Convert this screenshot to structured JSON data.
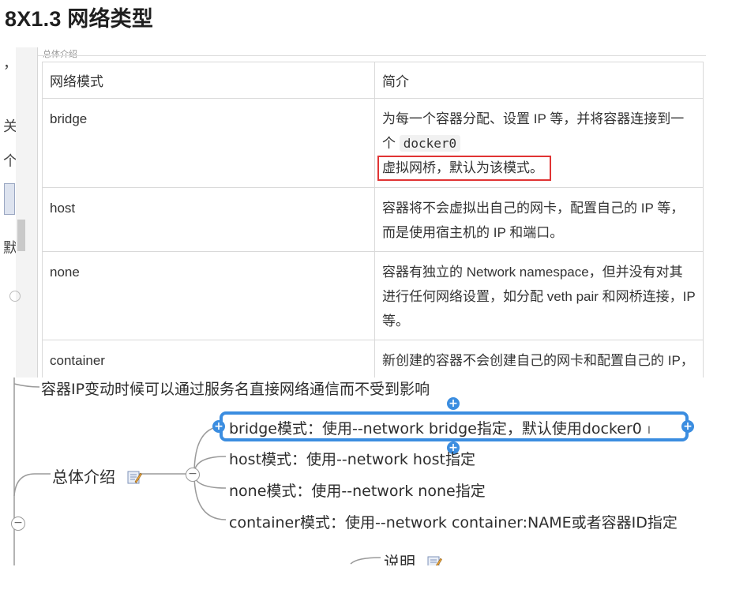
{
  "heading": "8X1.3 网络类型",
  "left_fragments": [
    "，",
    "关",
    "个",
    "默"
  ],
  "table": {
    "caption": "总体介绍",
    "headers": [
      "网络模式",
      "简介"
    ],
    "rows": [
      {
        "mode": "bridge",
        "desc_pre": "为每一个容器分配、设置 IP 等，并将容器连接到一个",
        "desc_code": "docker0",
        "desc_highlight": "虚拟网桥，默认为该模式。"
      },
      {
        "mode": "host",
        "desc": "容器将不会虚拟出自己的网卡，配置自己的 IP 等，而是使用宿主机的 IP 和端口。"
      },
      {
        "mode": "none",
        "desc": "容器有独立的 Network namespace，但并没有对其进行任何网络设置，如分配 veth pair 和网桥连接，IP 等。"
      },
      {
        "mode": "container",
        "desc": "新创建的容器不会创建自己的网卡和配置自己的 IP，而是和一个指定的容器共享 IP、端口范围"
      }
    ]
  },
  "mindmap": {
    "top_text": "容器IP变动时候可以通过服务名直接网络通信而不受到影响",
    "parent": "总体介绍",
    "children": [
      "bridge模式：使用--network  bridge指定，默认使用docker0",
      "host模式：使用--network host指定",
      "none模式：使用--network none指定",
      "container模式：使用--network container:NAME或者容器ID指定"
    ],
    "sibling": "说明",
    "accent_color": "#3b8de0"
  }
}
